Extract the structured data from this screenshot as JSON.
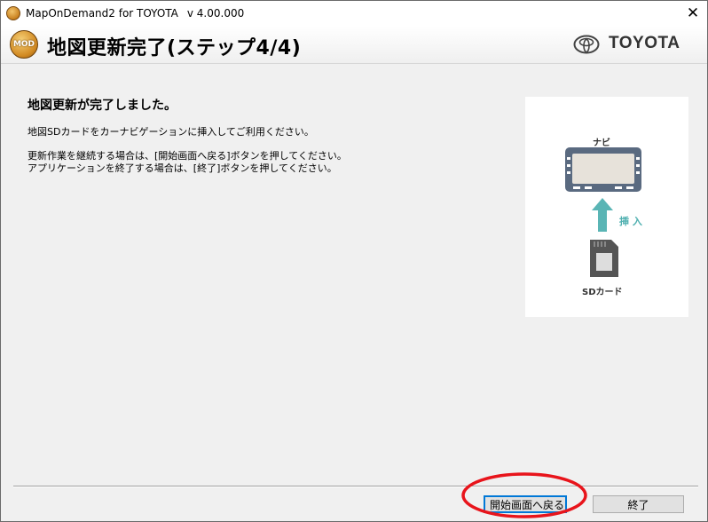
{
  "window": {
    "app_title": "MapOnDemand2 for TOYOTA",
    "version": "v 4.00.000",
    "close_glyph": "✕"
  },
  "header": {
    "logo_text": "MOD",
    "page_title": "地図更新完了(ステップ4/4)",
    "brand_text": "TOYOTA"
  },
  "content": {
    "heading": "地図更新が完了しました。",
    "line1": "地図SDカードをカーナビゲーションに挿入してご利用ください。",
    "line2": "更新作業を継続する場合は、[開始画面へ戻る]ボタンを押してください。",
    "line3": "アプリケーションを終了する場合は、[終了]ボタンを押してください。"
  },
  "illustration": {
    "navi_label": "ナビ",
    "insert_label": "挿 入",
    "sd_label": "SDカード"
  },
  "buttons": {
    "back_label": "開始画面へ戻る",
    "exit_label": "終了"
  },
  "colors": {
    "accent_blue": "#0078d7",
    "teal_arrow": "#5ab5b5",
    "annotation_red": "#e8141b",
    "navi_body": "#5a6a80"
  }
}
